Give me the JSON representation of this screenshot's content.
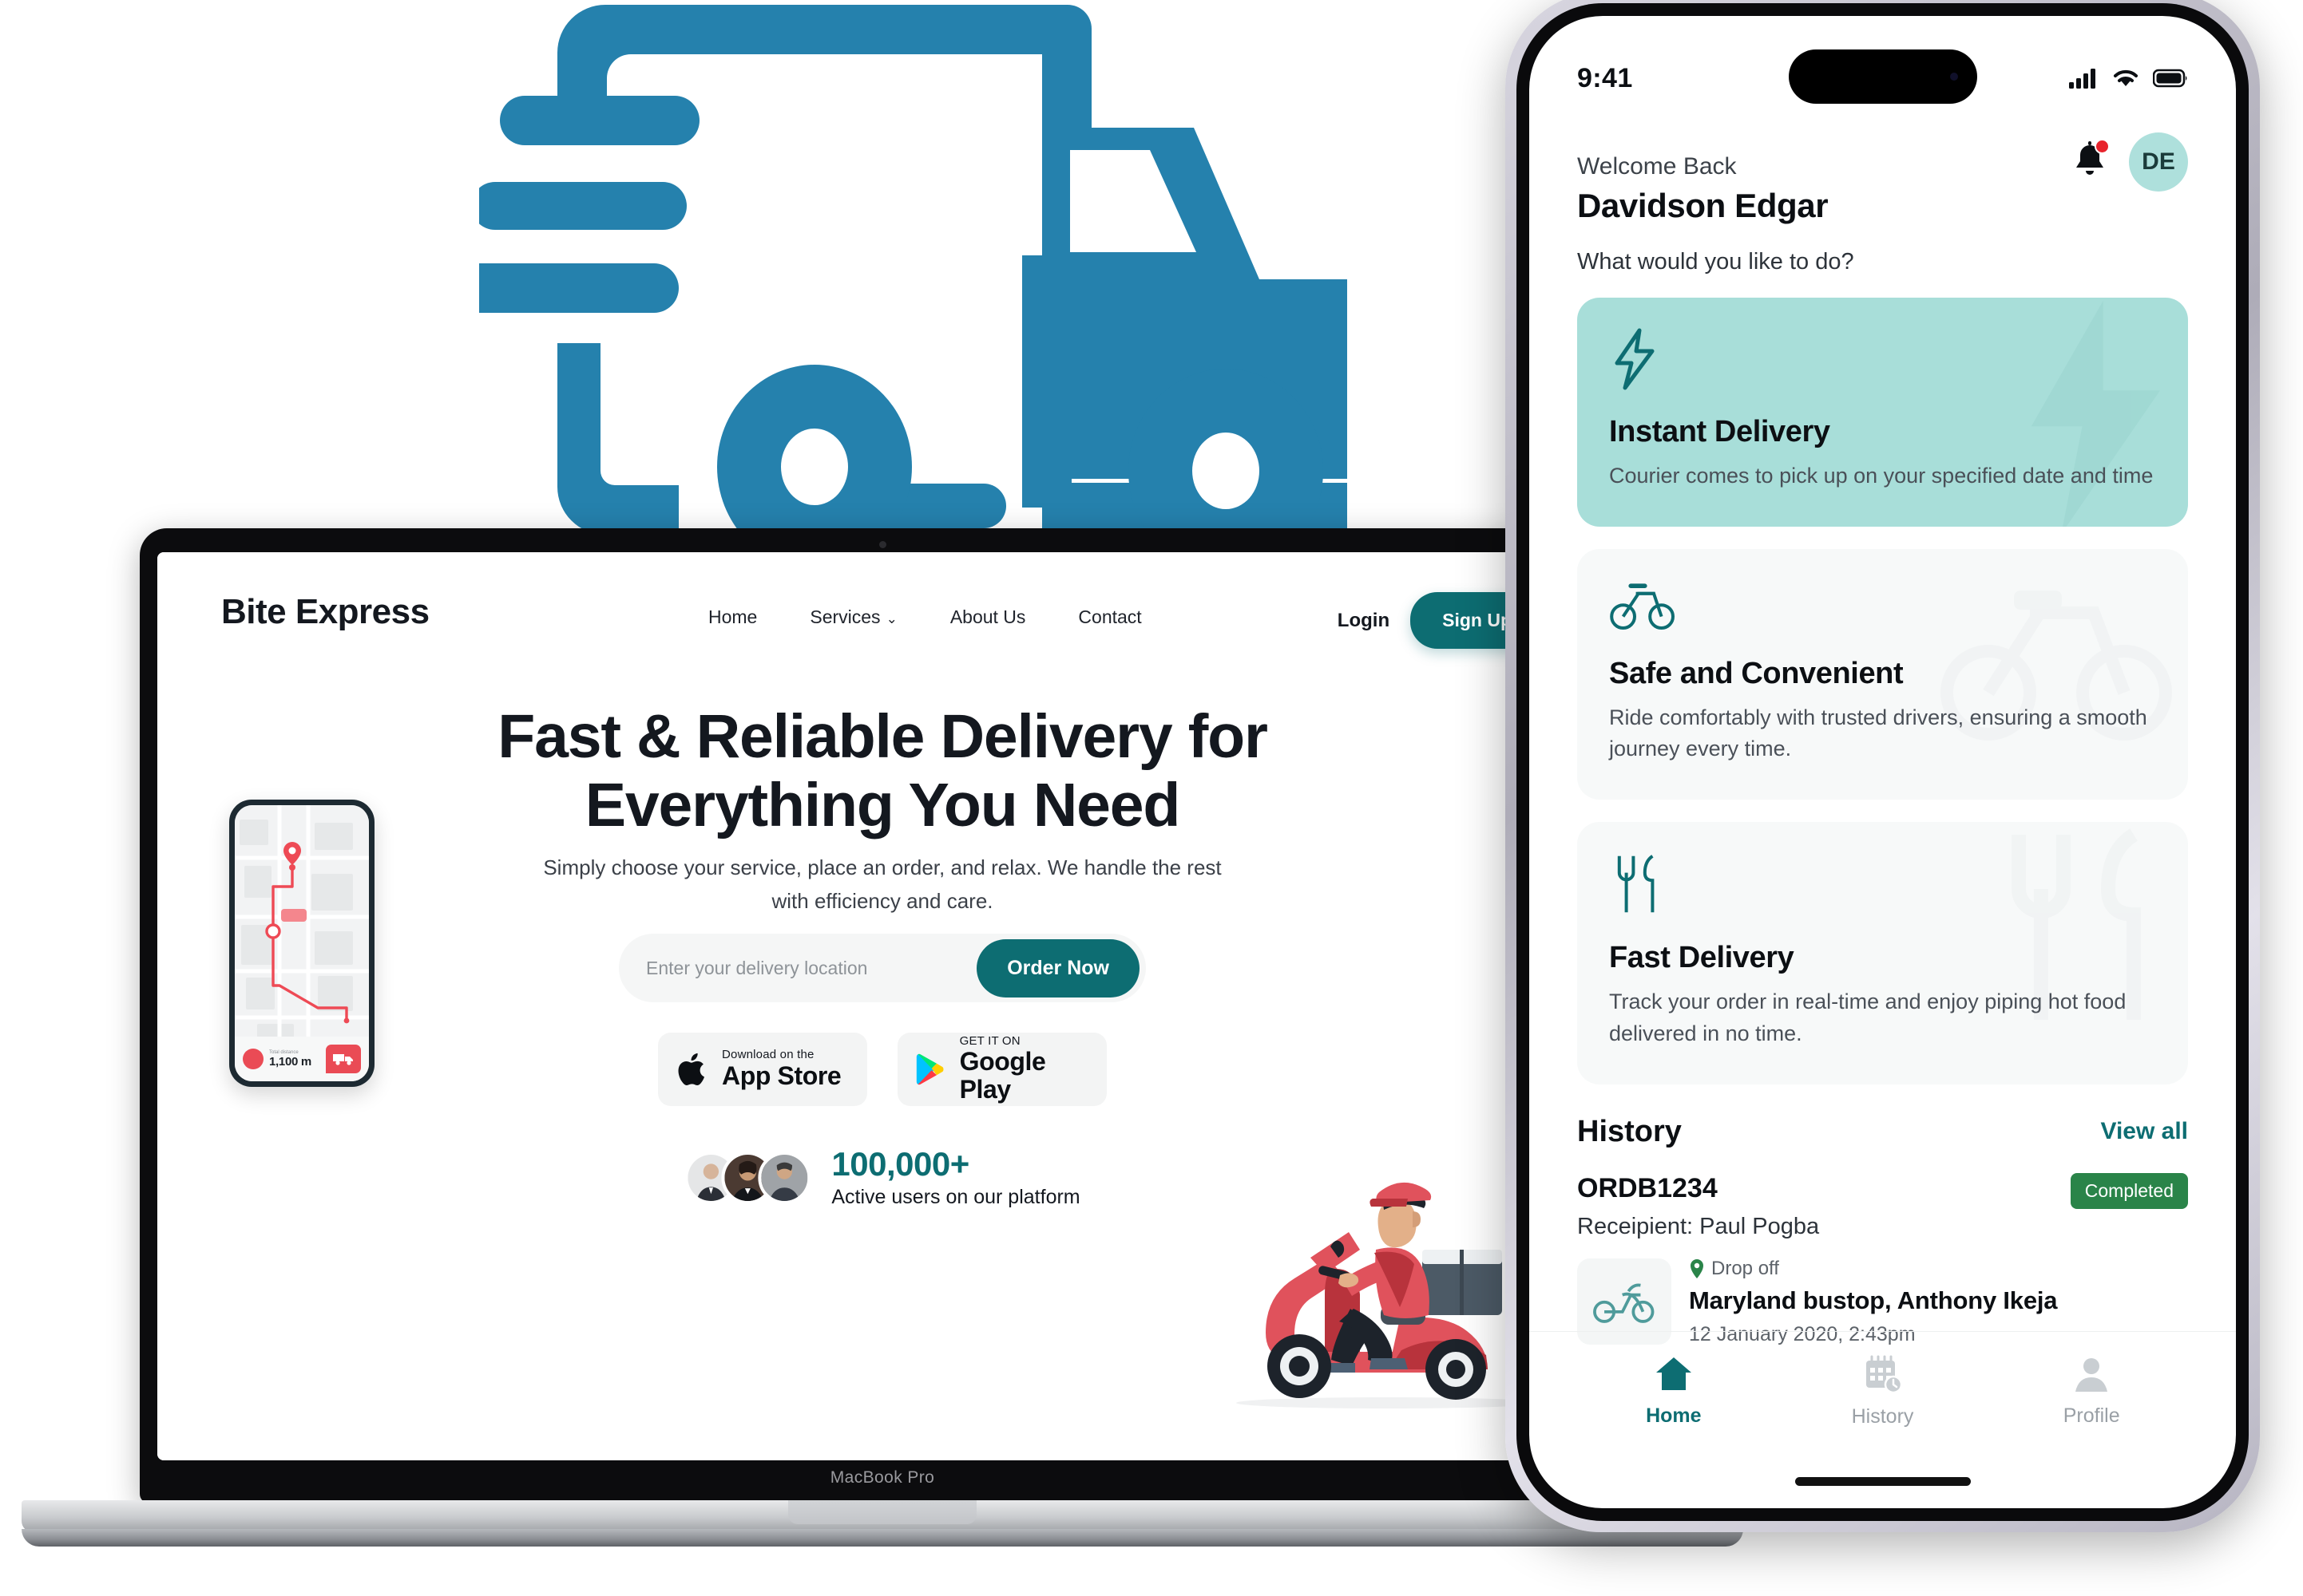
{
  "colors": {
    "brand_teal": "#0d6d72",
    "truck_blue": "#2581ad",
    "card_mint": "#a8ded9",
    "badge_green": "#2a8449",
    "scooter_red": "#e04b54"
  },
  "laptop": {
    "model_label": "MacBook Pro"
  },
  "website": {
    "brand": "Bite Express",
    "nav": [
      {
        "label": "Home",
        "has_caret": false
      },
      {
        "label": "Services",
        "has_caret": true
      },
      {
        "label": "About Us",
        "has_caret": false
      },
      {
        "label": "Contact",
        "has_caret": false
      }
    ],
    "login_label": "Login",
    "signup_label": "Sign Up",
    "hero_title": "Fast & Reliable Delivery for Everything You Need",
    "hero_subtitle": "Simply choose your service, place an order, and relax. We handle the rest with efficiency and care.",
    "search": {
      "placeholder": "Enter your delivery location",
      "value": "",
      "button_label": "Order Now"
    },
    "stores": [
      {
        "small": "Download on the",
        "big": "App Store",
        "icon": "apple-icon"
      },
      {
        "small": "GET IT ON",
        "big": "Google Play",
        "icon": "google-play-icon"
      }
    ],
    "stats": {
      "number": "100,000+",
      "caption": "Active users on our platform"
    },
    "map_phone": {
      "distance_label": "Total distance",
      "distance_value": "1,100 m"
    }
  },
  "phone": {
    "status": {
      "time": "9:41"
    },
    "header": {
      "welcome": "Welcome Back",
      "name": "Davidson Edgar",
      "avatar_initials": "DE",
      "prompt": "What would you like to do?"
    },
    "services": [
      {
        "title": "Instant Delivery",
        "desc": "Courier comes to pick up on your specified date and time",
        "icon": "lightning-bolt-icon",
        "style": "primary"
      },
      {
        "title": "Safe and Convenient",
        "desc": "Ride comfortably with trusted drivers, ensuring a smooth journey every time.",
        "icon": "bicycle-icon",
        "style": "plain"
      },
      {
        "title": "Fast Delivery",
        "desc": "Track your order in real-time and enjoy piping hot food delivered in no time.",
        "icon": "fork-knife-icon",
        "style": "plain"
      }
    ],
    "history": {
      "title": "History",
      "view_all": "View all",
      "item": {
        "order_id": "ORDB1234",
        "recipient": "Receipient: Paul Pogba",
        "status": "Completed",
        "drop_label": "Drop off",
        "address": "Maryland bustop, Anthony Ikeja",
        "datetime": "12 January 2020, 2:43pm"
      }
    },
    "tabs": [
      {
        "label": "Home",
        "icon": "home-icon",
        "active": true
      },
      {
        "label": "History",
        "icon": "calendar-clock-icon",
        "active": false
      },
      {
        "label": "Profile",
        "icon": "person-icon",
        "active": false
      }
    ]
  }
}
